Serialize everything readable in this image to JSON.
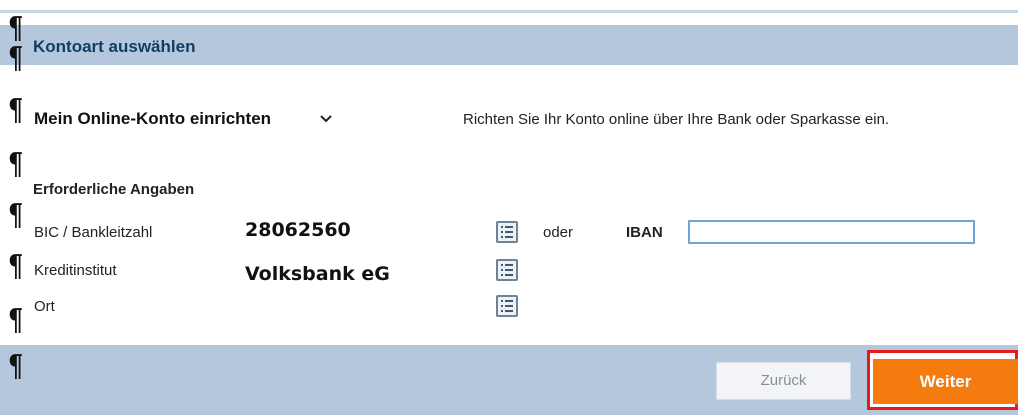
{
  "header": {
    "title": "Kontoart auswählen"
  },
  "section": {
    "title": "Mein Online-Konto einrichten",
    "description": "Richten Sie Ihr Konto online über Ihre Bank oder Sparkasse ein."
  },
  "form": {
    "required_heading": "Erforderliche Angaben",
    "bic_label": "BIC / Bankleitzahl",
    "bic_value": "28062560",
    "or_label": "oder",
    "iban_label": "IBAN",
    "iban_value": "",
    "institute_label": "Kreditinstitut",
    "institute_value": "Volksbank eG",
    "city_label": "Ort",
    "city_value": ""
  },
  "footer": {
    "back_label": "Zurück",
    "next_label": "Weiter"
  },
  "marks": {
    "pilcrow": "¶"
  },
  "colors": {
    "band": "#b5c7dd",
    "header_text": "#123e64",
    "next_button": "#f57b0f",
    "highlight_frame": "#e41b1b"
  }
}
